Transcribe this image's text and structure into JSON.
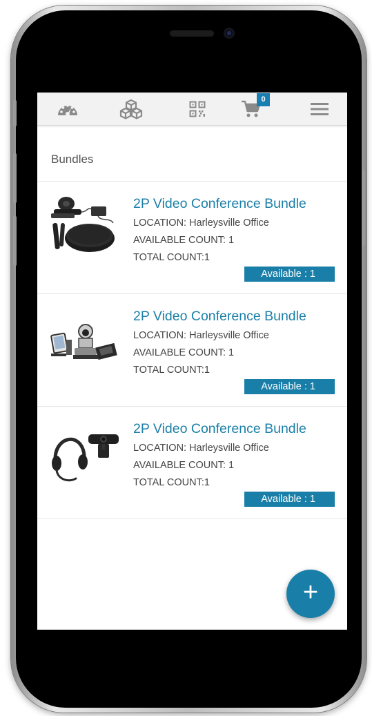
{
  "nav": {
    "items": [
      {
        "id": "dashboard",
        "icon": "dashboard-gauge-icon"
      },
      {
        "id": "inventory",
        "icon": "boxes-icon"
      },
      {
        "id": "scan",
        "icon": "qr-code-icon"
      },
      {
        "id": "cart",
        "icon": "cart-icon",
        "badge": "0"
      },
      {
        "id": "menu",
        "icon": "hamburger-menu-icon"
      }
    ]
  },
  "section": {
    "title": "Bundles"
  },
  "bundles": [
    {
      "title": "2P Video Conference Bundle",
      "location": "LOCATION: Harleysville Office",
      "available_count": "AVAILABLE COUNT: 1",
      "total_count": "TOTAL COUNT:1",
      "status": "Available : 1",
      "image": "conference-camera-speakerphone-image"
    },
    {
      "title": "2P Video Conference Bundle",
      "location": "LOCATION: Harleysville Office",
      "available_count": "AVAILABLE COUNT: 1",
      "total_count": "TOTAL COUNT:1",
      "status": "Available : 1",
      "image": "conference-ptz-camera-kit-image"
    },
    {
      "title": "2P Video Conference Bundle",
      "location": "LOCATION: Harleysville Office",
      "available_count": "AVAILABLE COUNT: 1",
      "total_count": "TOTAL COUNT:1",
      "status": "Available : 1",
      "image": "headset-webcam-image"
    }
  ],
  "fab": {
    "label": "+"
  },
  "colors": {
    "accent": "#1a7fa8",
    "nav_bg": "#f2f2f2",
    "icon": "#8a8a8a"
  }
}
